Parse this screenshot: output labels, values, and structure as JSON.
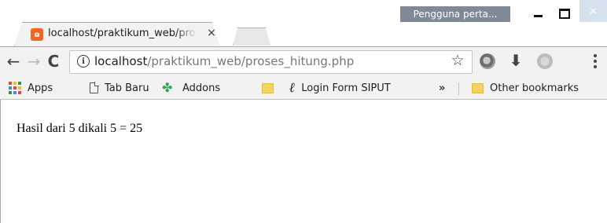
{
  "window": {
    "profile_label": "Pengguna perta...",
    "close_label": "×",
    "tab": {
      "title": "localhost/praktikum_web/proses_hitung.php",
      "favicon_glyph": "ɷ",
      "close_label": "×"
    }
  },
  "toolbar": {
    "back_icon": "←",
    "forward_icon": "→",
    "reload_icon": "C",
    "info_icon": "i",
    "url_host": "localhost",
    "url_path": "/praktikum_web/proses_hitung.php",
    "star_icon": "☆",
    "download_icon": "⬇"
  },
  "bookmarks": {
    "items": [
      {
        "label": "Apps",
        "icon": "apps-grid-icon"
      },
      {
        "label": "Tab Baru",
        "icon": "page-icon"
      },
      {
        "label": "Addons",
        "icon": "puzzle-icon"
      },
      {
        "label": "",
        "icon": "folder-icon"
      },
      {
        "label": "Login Form SIPUT",
        "icon": "script-l-icon"
      }
    ],
    "overflow_icon": "»",
    "other_label": "Other bookmarks"
  },
  "page": {
    "result_text": "Hasil dari 5 dikali 5 = 25"
  },
  "colors": {
    "apps_grid": [
      "#e8453c",
      "#f9bb2d",
      "#3a8f4b",
      "#4a89dc",
      "#e8453c",
      "#f9bb2d",
      "#3a8f4b",
      "#4a89dc",
      "#e8453c"
    ]
  }
}
